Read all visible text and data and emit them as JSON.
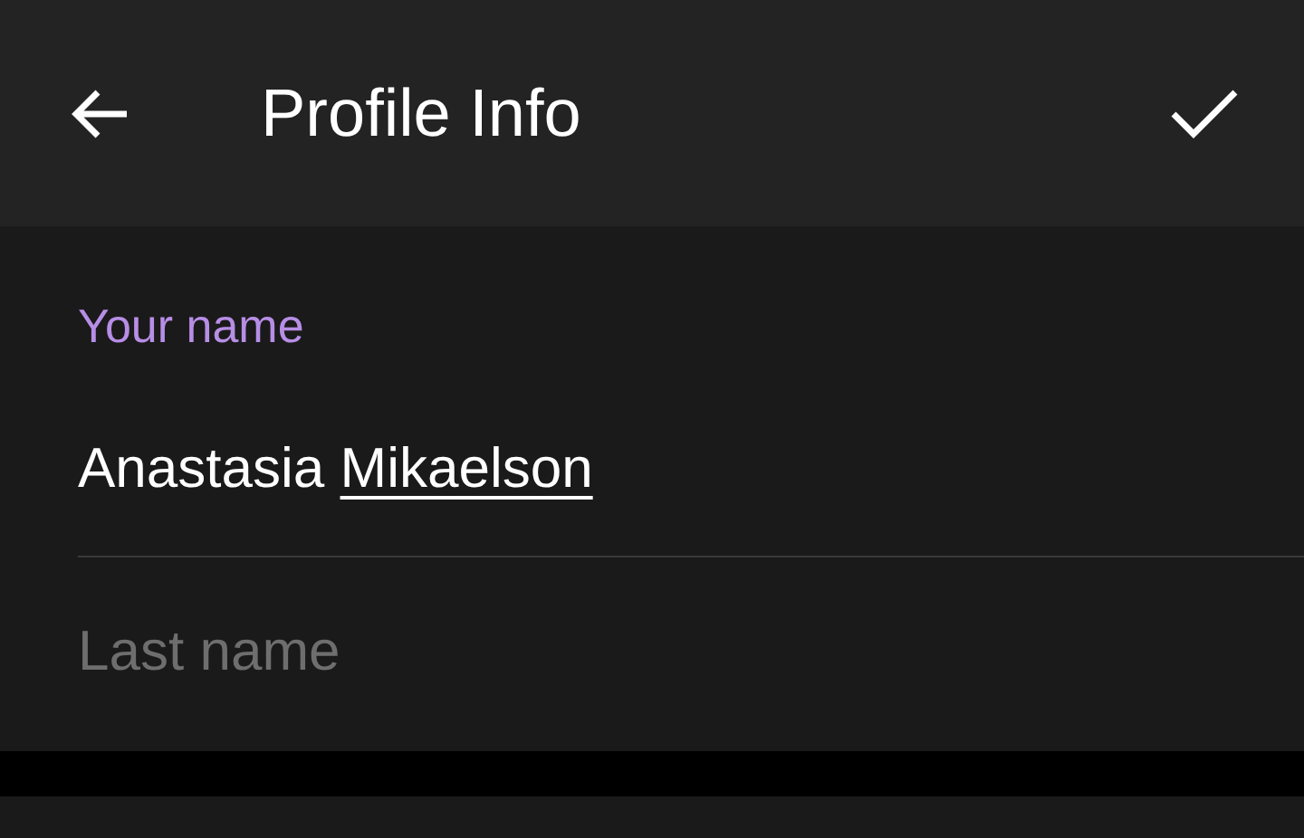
{
  "header": {
    "title": "Profile Info"
  },
  "first_name": {
    "label": "Your name",
    "words": [
      {
        "text": "Anastasia",
        "flagged": false
      },
      {
        "text": "Mikaelson",
        "flagged": true
      }
    ]
  },
  "last_name": {
    "placeholder": "Last name"
  }
}
